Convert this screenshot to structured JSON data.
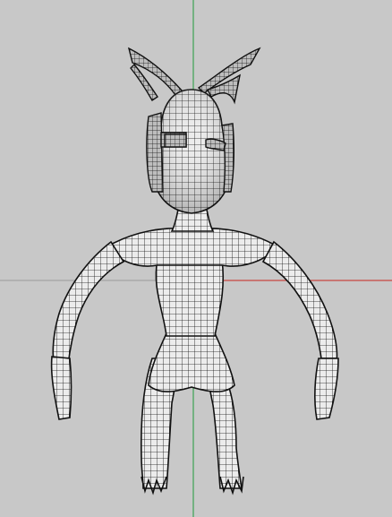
{
  "viewport": {
    "background": "#c8c8c8",
    "axis_y_color": "#1f9a3a",
    "axis_x_color": "#c8261e",
    "grid_line_color": "#9a9a9a",
    "mesh_color": "#111111",
    "surface_color": "#ececec",
    "surface_shadow_color": "#bdbdbd"
  },
  "model": {
    "render_style": "wireframe-shaded",
    "view": "front"
  }
}
